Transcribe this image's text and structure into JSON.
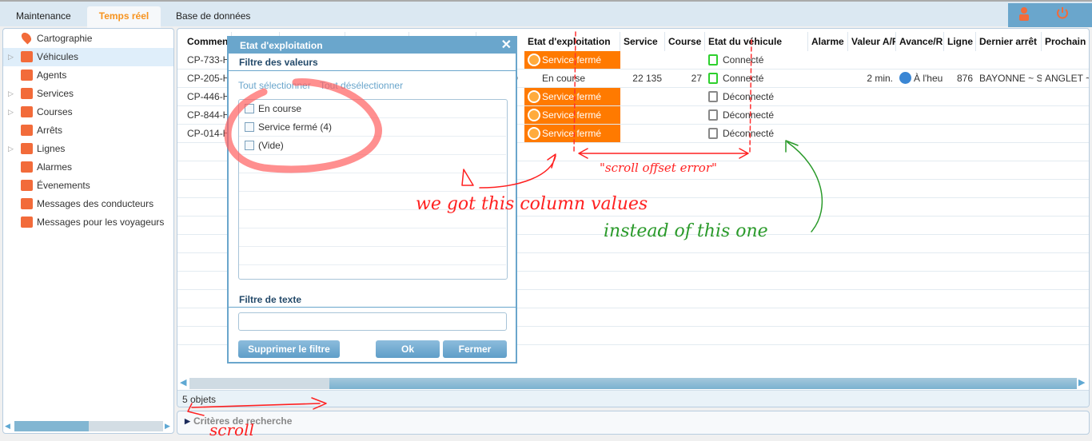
{
  "tabs": [
    {
      "label": "Maintenance"
    },
    {
      "label": "Temps réel",
      "active": true
    },
    {
      "label": "Base de données"
    }
  ],
  "header_icons": [
    "user-icon",
    "power-icon"
  ],
  "sidebar": {
    "items": [
      {
        "label": "Cartographie",
        "icon": "map-pin-icon",
        "expandable": false
      },
      {
        "label": "Véhicules",
        "icon": "vehicle-folder-icon",
        "expandable": true,
        "selected": true
      },
      {
        "label": "Agents",
        "icon": "agent-folder-icon",
        "expandable": false
      },
      {
        "label": "Services",
        "icon": "service-folder-icon",
        "expandable": true
      },
      {
        "label": "Courses",
        "icon": "course-folder-icon",
        "expandable": true
      },
      {
        "label": "Arrêts",
        "icon": "stop-folder-icon",
        "expandable": false
      },
      {
        "label": "Lignes",
        "icon": "line-folder-icon",
        "expandable": true
      },
      {
        "label": "Alarmes",
        "icon": "alarm-folder-icon",
        "expandable": false
      },
      {
        "label": "Évenements",
        "icon": "event-folder-icon",
        "expandable": false
      },
      {
        "label": "Messages des conducteurs",
        "icon": "driver-message-icon",
        "expandable": false
      },
      {
        "label": "Messages pour les voyageurs",
        "icon": "traveler-message-icon",
        "expandable": false
      }
    ]
  },
  "grid": {
    "columns": [
      "Commen",
      "",
      "",
      "",
      "",
      "Etat d'exploitation",
      "Service",
      "Course",
      "Etat du véhicule",
      "Alarme",
      "Valeur A/R",
      "Avance/R",
      "Ligne",
      "Dernier arrêt",
      "Prochain a"
    ],
    "rows": [
      {
        "comment": "CP-733-H",
        "hidden": "",
        "etat": "Service fermé",
        "etat_closed": true,
        "service": "",
        "course": "",
        "vehicule": "Connecté",
        "connected": true,
        "valeur": "",
        "avance": "",
        "ligne": "",
        "dernier": "",
        "prochain": ""
      },
      {
        "comment": "CP-205-H",
        "hidden": "D",
        "etat": "En course",
        "etat_closed": false,
        "service": "22 135",
        "course": "27",
        "vehicule": "Connecté",
        "connected": true,
        "valeur": "2 min.",
        "avance": "À l'heu",
        "ligne": "876",
        "dernier": "BAYONNE ~ S",
        "prochain": "ANGLET ~"
      },
      {
        "comment": "CP-446-H",
        "hidden": "",
        "etat": "Service fermé",
        "etat_closed": true,
        "service": "",
        "course": "",
        "vehicule": "Déconnecté",
        "connected": false,
        "valeur": "",
        "avance": "",
        "ligne": "",
        "dernier": "",
        "prochain": ""
      },
      {
        "comment": "CP-844-H",
        "hidden": "",
        "etat": "Service fermé",
        "etat_closed": true,
        "service": "",
        "course": "",
        "vehicule": "Déconnecté",
        "connected": false,
        "valeur": "",
        "avance": "",
        "ligne": "",
        "dernier": "",
        "prochain": ""
      },
      {
        "comment": "CP-014-H",
        "hidden": "",
        "etat": "Service fermé",
        "etat_closed": true,
        "service": "",
        "course": "",
        "vehicule": "Déconnecté",
        "connected": false,
        "valeur": "",
        "avance": "",
        "ligne": "",
        "dernier": "",
        "prochain": ""
      }
    ],
    "status": "5 objets",
    "criteria": "Critères de recherche"
  },
  "dialog": {
    "title": "Etat d'exploitation",
    "values_section": "Filtre des valeurs",
    "select_all": "Tout sélectionner",
    "deselect_all": "Tout désélectionner",
    "options": [
      {
        "label": "En course",
        "checked": false
      },
      {
        "label": "Service fermé (4)",
        "checked": false
      },
      {
        "label": "(Vide)",
        "checked": false
      }
    ],
    "text_section": "Filtre de texte",
    "text_value": "",
    "remove_filter": "Supprimer le filtre",
    "ok": "Ok",
    "close": "Fermer"
  },
  "annotations": {
    "scroll_offset": "\"scroll offset error\"",
    "we_got": "we got this column values",
    "instead": "instead of this one",
    "scroll": "scroll"
  },
  "colors": {
    "accent": "#f7931e",
    "header_blue": "#6aa6cc",
    "closed": "#ff7a00",
    "connected": "#2ed02e",
    "annotation_red": "#ff2020",
    "annotation_green": "#2a9a2a"
  }
}
